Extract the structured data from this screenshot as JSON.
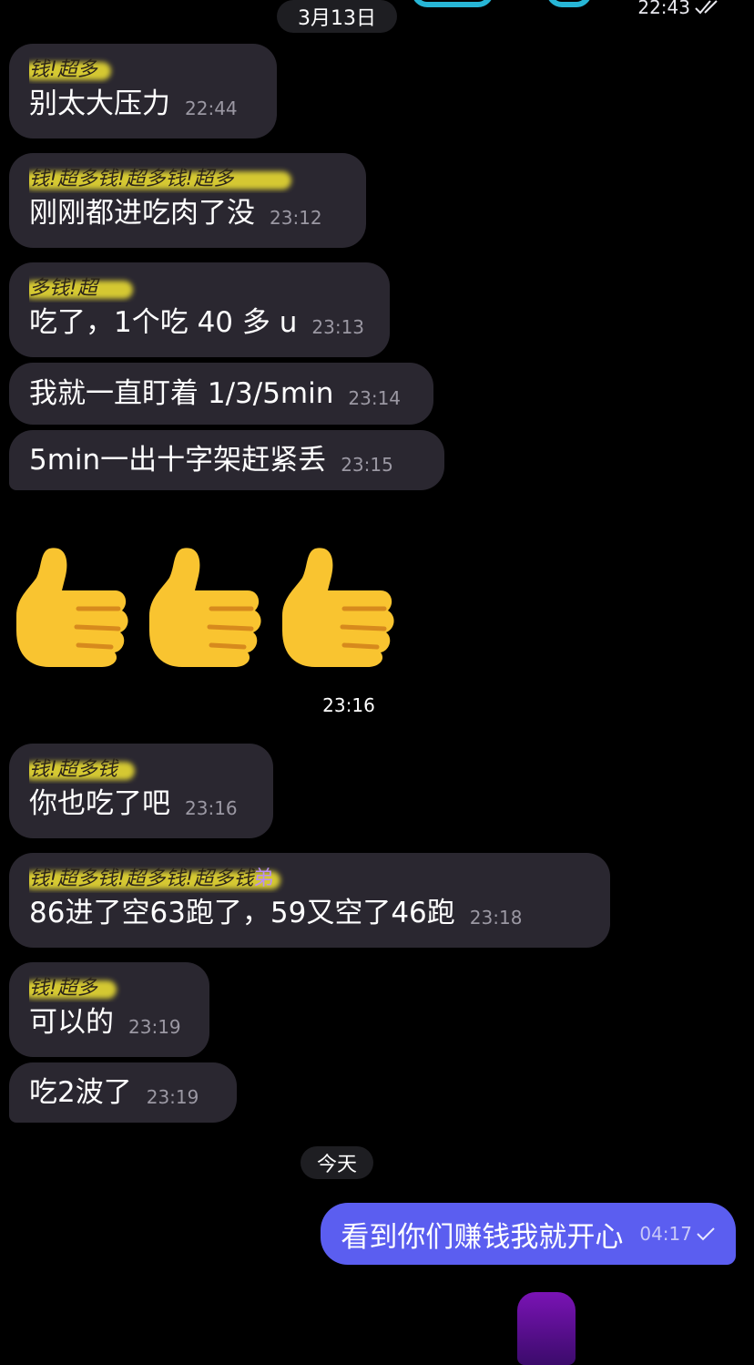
{
  "header": {
    "date_label": "3月13日",
    "prev_time": "22:43"
  },
  "messages": [
    {
      "sender": "钱!超多",
      "text": "别太大压力",
      "time": "22:44"
    },
    {
      "sender": "钱!超多钱!超多钱!超多",
      "text": "刚刚都进吃肉了没",
      "time": "23:12"
    },
    {
      "sender": "多钱!超",
      "text": "吃了，1个吃 40 多 u",
      "time": "23:13"
    },
    {
      "sender": "",
      "text": "我就一直盯着 1/3/5min",
      "time": "23:14"
    },
    {
      "sender": "",
      "text": "5min一出十字架赶紧丢",
      "time": "23:15"
    }
  ],
  "emoji_message": {
    "emojis": [
      "👍",
      "👍",
      "👍"
    ],
    "time": "23:16"
  },
  "messages2": [
    {
      "sender": "钱!超多钱",
      "text": "你也吃了吧",
      "time": "23:16"
    },
    {
      "sender": "钱!超多钱!超多钱!超多钱",
      "sender_suffix": "弟",
      "text": "86进了空63跑了，59又空了46跑",
      "time": "23:18"
    },
    {
      "sender": "钱!超多",
      "text": "可以的",
      "time": "23:19"
    },
    {
      "sender": "",
      "text": "吃2波了",
      "time": "23:19"
    }
  ],
  "today_label": "今天",
  "outgoing": {
    "text": "看到你们赚钱我就开心",
    "time": "04:17"
  },
  "colors": {
    "background": "#000000",
    "incoming_bubble": "#2a2730",
    "outgoing_bubble": "#5b5ef0",
    "highlight": "#f3e533"
  }
}
